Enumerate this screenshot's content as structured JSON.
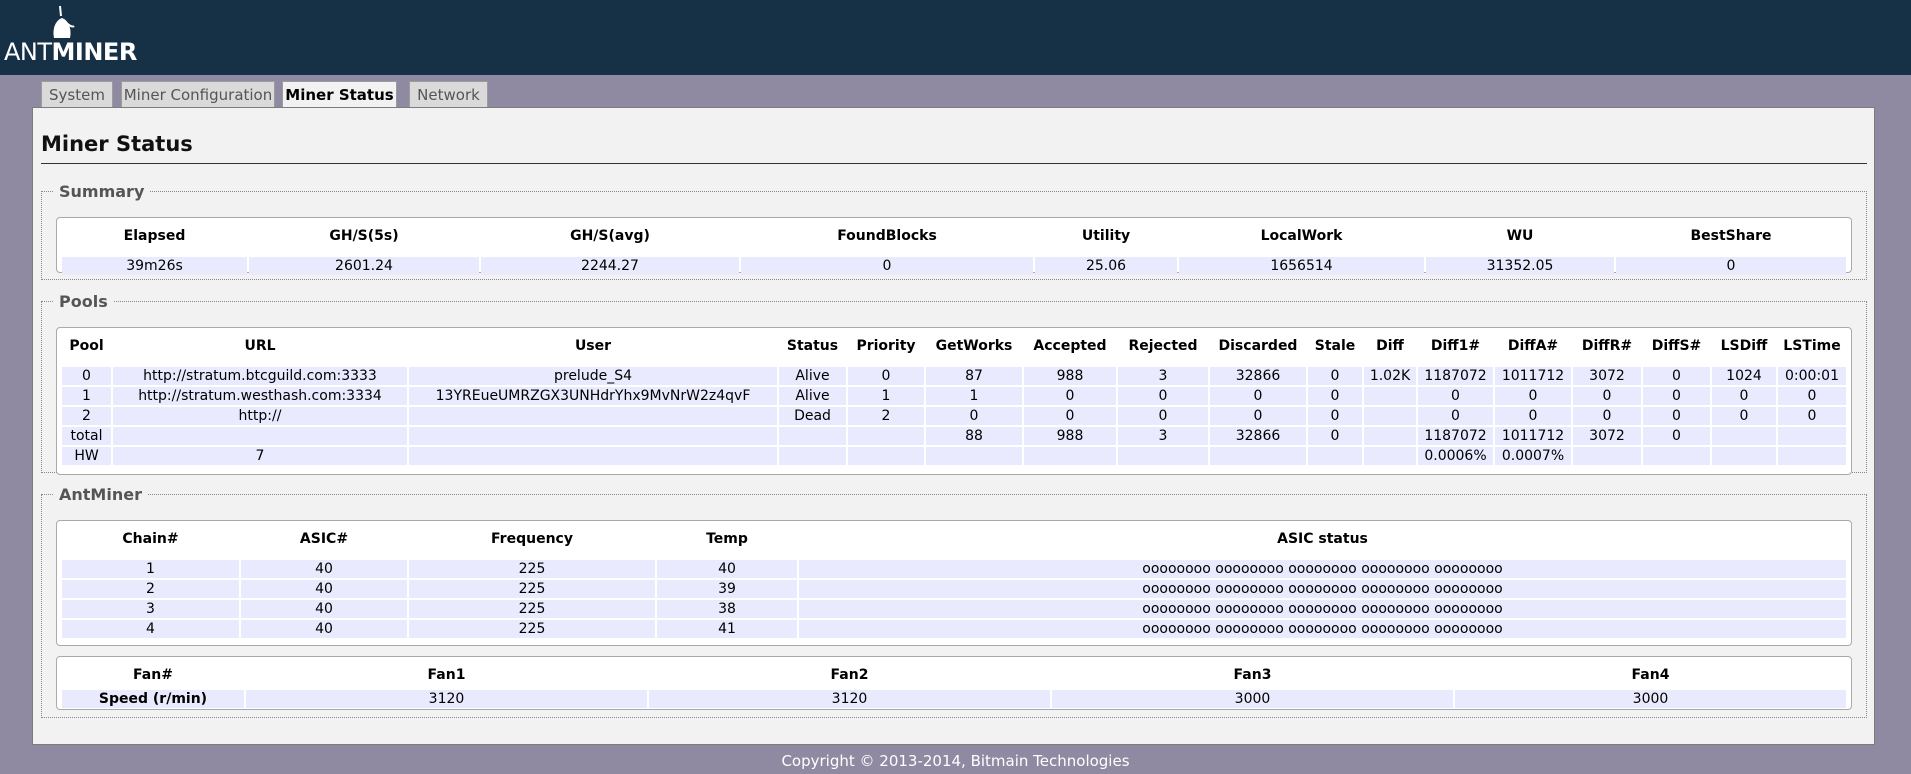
{
  "brand": {
    "ant": "ANT",
    "miner": "MINER"
  },
  "tabs": [
    {
      "label": "System"
    },
    {
      "label": "Miner Configuration"
    },
    {
      "label": "Miner Status"
    },
    {
      "label": "Network"
    }
  ],
  "page_title": "Miner Status",
  "summary": {
    "legend": "Summary",
    "headers": [
      "Elapsed",
      "GH/S(5s)",
      "GH/S(avg)",
      "FoundBlocks",
      "Utility",
      "LocalWork",
      "WU",
      "BestShare"
    ],
    "row": [
      "39m26s",
      "2601.24",
      "2244.27",
      "0",
      "25.06",
      "1656514",
      "31352.05",
      "0"
    ]
  },
  "pools": {
    "legend": "Pools",
    "headers": [
      "Pool",
      "URL",
      "User",
      "Status",
      "Priority",
      "GetWorks",
      "Accepted",
      "Rejected",
      "Discarded",
      "Stale",
      "Diff",
      "Diff1#",
      "DiffA#",
      "DiffR#",
      "DiffS#",
      "LSDiff",
      "LSTime"
    ],
    "rows": [
      [
        "0",
        "http://stratum.btcguild.com:3333",
        "prelude_S4",
        "Alive",
        "0",
        "87",
        "988",
        "3",
        "32866",
        "0",
        "1.02K",
        "1187072",
        "1011712",
        "3072",
        "0",
        "1024",
        "0:00:01"
      ],
      [
        "1",
        "http://stratum.westhash.com:3334",
        "13YREueUMRZGX3UNHdrYhx9MvNrW2z4qvF",
        "Alive",
        "1",
        "1",
        "0",
        "0",
        "0",
        "0",
        "",
        "0",
        "0",
        "0",
        "0",
        "0",
        "0"
      ],
      [
        "2",
        "http://",
        "",
        "Dead",
        "2",
        "0",
        "0",
        "0",
        "0",
        "0",
        "",
        "0",
        "0",
        "0",
        "0",
        "0",
        "0"
      ],
      [
        "total",
        "",
        "",
        "",
        "",
        "88",
        "988",
        "3",
        "32866",
        "0",
        "",
        "1187072",
        "1011712",
        "3072",
        "0",
        "",
        ""
      ],
      [
        "HW",
        "7",
        "",
        "",
        "",
        "",
        "",
        "",
        "",
        "",
        "",
        "0.0006%",
        "0.0007%",
        "",
        "",
        "",
        ""
      ]
    ]
  },
  "antminer": {
    "legend": "AntMiner",
    "headers": [
      "Chain#",
      "ASIC#",
      "Frequency",
      "Temp",
      "ASIC status"
    ],
    "rows": [
      [
        "1",
        "40",
        "225",
        "40",
        "oooooooo oooooooo oooooooo oooooooo oooooooo"
      ],
      [
        "2",
        "40",
        "225",
        "39",
        "oooooooo oooooooo oooooooo oooooooo oooooooo"
      ],
      [
        "3",
        "40",
        "225",
        "38",
        "oooooooo oooooooo oooooooo oooooooo oooooooo"
      ],
      [
        "4",
        "40",
        "225",
        "41",
        "oooooooo oooooooo oooooooo oooooooo oooooooo"
      ]
    ],
    "fans": {
      "headers": [
        "Fan#",
        "Fan1",
        "Fan2",
        "Fan3",
        "Fan4"
      ],
      "row_label": "Speed (r/min)",
      "speeds": [
        "3120",
        "3120",
        "3000",
        "3000"
      ]
    }
  },
  "copyright": "Copyright © 2013-2014, Bitmain Technologies",
  "colors": {
    "header_bg": "#163045",
    "page_bg": "#8f8aa1",
    "cell_bg": "#eaeaff"
  }
}
